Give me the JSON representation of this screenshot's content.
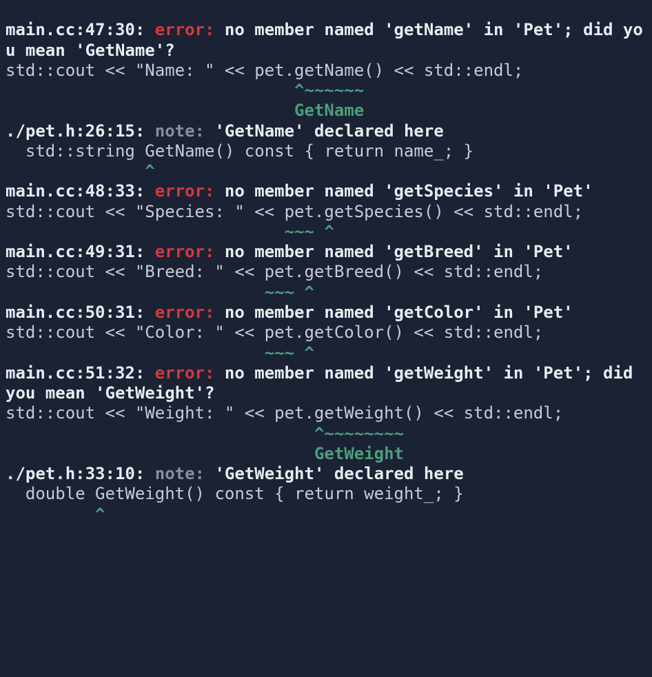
{
  "errors": [
    {
      "loc": "main.cc:47:30: ",
      "tag": "error:",
      "msg": " no member named 'getName' in 'Pet'; did you mean 'GetName'?",
      "code": "std::cout << \"Name: \" << pet.getName() << std::endl;",
      "caret": "                             ^~~~~~~",
      "fixit": "                             GetName",
      "note_loc": "./pet.h:26:15: ",
      "note_tag": "note:",
      "note_msg": " 'GetName' declared here",
      "note_code": "  std::string GetName() const { return name_; }",
      "note_caret": "              ^"
    },
    {
      "loc": "main.cc:48:33: ",
      "tag": "error:",
      "msg": " no member named 'getSpecies' in 'Pet'",
      "code": "std::cout << \"Species: \" << pet.getSpecies() << std::endl;",
      "caret": "                            ~~~ ^"
    },
    {
      "loc": "main.cc:49:31: ",
      "tag": "error:",
      "msg": " no member named 'getBreed' in 'Pet'",
      "code": "std::cout << \"Breed: \" << pet.getBreed() << std::endl;",
      "caret": "                          ~~~ ^"
    },
    {
      "loc": "main.cc:50:31: ",
      "tag": "error:",
      "msg": " no member named 'getColor' in 'Pet'",
      "code": "std::cout << \"Color: \" << pet.getColor() << std::endl;",
      "caret": "                          ~~~ ^"
    },
    {
      "loc": "main.cc:51:32: ",
      "tag": "error:",
      "msg": " no member named 'getWeight' in 'Pet'; did you mean 'GetWeight'?",
      "code": "std::cout << \"Weight: \" << pet.getWeight() << std::endl;",
      "caret": "                               ^~~~~~~~~",
      "fixit": "                               GetWeight",
      "note_loc": "./pet.h:33:10: ",
      "note_tag": "note:",
      "note_msg": " 'GetWeight' declared here",
      "note_code": "  double GetWeight() const { return weight_; }",
      "note_caret": "         ^"
    }
  ]
}
